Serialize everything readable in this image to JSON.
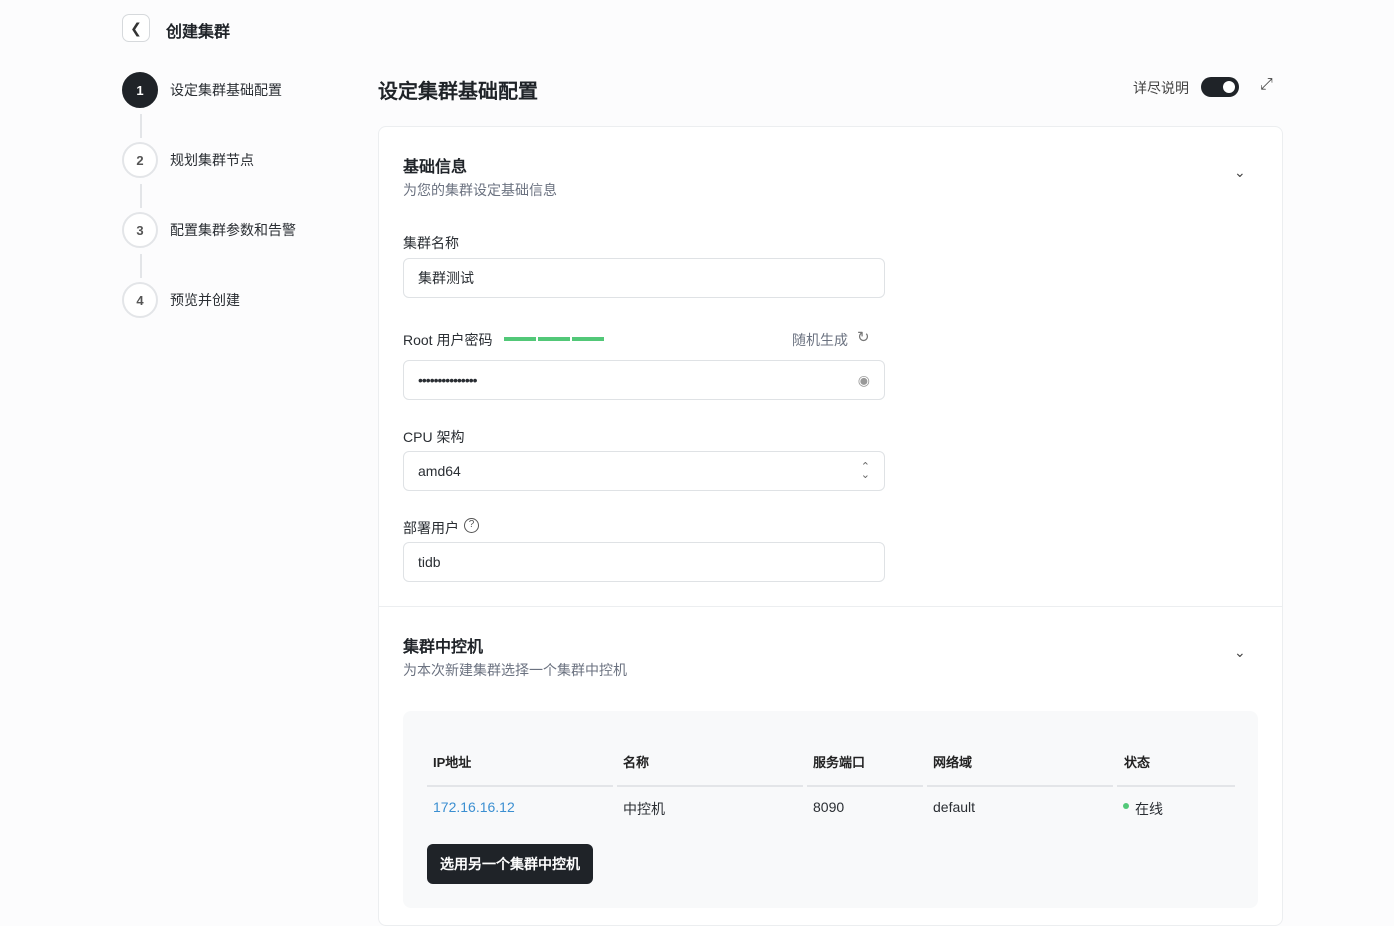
{
  "header": {
    "title": "创建集群"
  },
  "steps": [
    {
      "num": "1",
      "label": "设定集群基础配置"
    },
    {
      "num": "2",
      "label": "规划集群节点"
    },
    {
      "num": "3",
      "label": "配置集群参数和告警"
    },
    {
      "num": "4",
      "label": "预览并创建"
    }
  ],
  "main": {
    "title": "设定集群基础配置",
    "detail_toggle_label": "详尽说明",
    "detail_toggle_on": true
  },
  "basic": {
    "title": "基础信息",
    "subtitle": "为您的集群设定基础信息",
    "name_label": "集群名称",
    "name_value": "集群测试",
    "password_label": "Root 用户密码",
    "password_strength": "3/3",
    "random_label": "随机生成",
    "password_value": "•••••••••••••••",
    "cpu_label": "CPU 架构",
    "cpu_value": "amd64",
    "user_label": "部署用户",
    "user_value": "tidb"
  },
  "control": {
    "title": "集群中控机",
    "subtitle": "为本次新建集群选择一个集群中控机",
    "columns": [
      "IP地址",
      "名称",
      "服务端口",
      "网络域",
      "状态"
    ],
    "row": {
      "ip": "172.16.16.12",
      "name": "中控机",
      "port": "8090",
      "domain": "default",
      "status": "在线"
    },
    "button": "选用另一个集群中控机"
  },
  "colors": {
    "accent": "#1f2328",
    "strength": "#52c878",
    "link": "#3b8fd1",
    "online": "#52c878"
  }
}
